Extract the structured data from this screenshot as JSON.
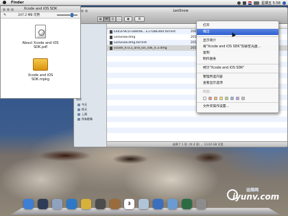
{
  "menubar": {
    "app_name": "Finder",
    "clock": "星期五 5:58",
    "icons": [
      "wifi-icon",
      "volume-icon",
      "flag-icon",
      "battery-icon",
      "search-icon"
    ]
  },
  "desktop_drive": {
    "label": "XCode and iOS SDK"
  },
  "open_panel": {
    "title": "Xcode and iOS SDK",
    "info": "247.2 MB 可用",
    "items": [
      {
        "label": "About Xcode and iOS SDK.pdf",
        "icon": "pdf-document-icon"
      },
      {
        "label": "Xcode and iOS SDK.mpkg",
        "icon": "installer-package-icon"
      }
    ]
  },
  "finder": {
    "title": "LeoSnow",
    "files": [
      {
        "name": "E643F9E5F1B809E...E17D8E460.torrent",
        "date": "2009年8月30"
      },
      {
        "name": "LeoSnow.dmg",
        "date": "2011年6月5"
      },
      {
        "name": "LeoSnow.dmg.torrent",
        "date": "2011年6月9"
      },
      {
        "name": "xcode_4.0.2_and_ios_sdk_4.3.dmg",
        "date": "2011年6月5"
      }
    ],
    "sidebar": {
      "heading": "搜索",
      "items": [
        "今天",
        "昨天",
        "上周",
        "所有影像"
      ]
    },
    "status": "选择了 1 项（共 4 项），13.02 GB 可用"
  },
  "context_menu": {
    "items": [
      {
        "label": "打开",
        "highlighted": false
      },
      {
        "label": "推出",
        "highlighted": true
      },
      {
        "label": "显示简介",
        "highlighted": false
      },
      {
        "label": "将\"Xcode and iOS SDK\"刻录至光盘...",
        "highlighted": false
      },
      {
        "label": "复制",
        "highlighted": false
      },
      {
        "label": "制作替身",
        "highlighted": false
      },
      {
        "label": "拷贝\"Xcode and iOS SDK\"",
        "highlighted": false
      },
      {
        "label": "整理所选内容",
        "highlighted": false
      },
      {
        "label": "查看显示选项",
        "highlighted": false
      },
      {
        "label": "标签：",
        "highlighted": false
      },
      {
        "label": "文件夹操作设置...",
        "highlighted": false
      }
    ],
    "label_colors": [
      "#ffffff",
      "#f08a7a",
      "#f2b566",
      "#f1e26a",
      "#b2dc6c",
      "#86b6ee",
      "#c49be0",
      "#bdbdbd"
    ]
  },
  "dock": {
    "icons": [
      {
        "name": "finder-icon",
        "color": "#3d7fd6"
      },
      {
        "name": "dashboard-icon",
        "color": "#2f3c58"
      },
      {
        "name": "mail-icon",
        "color": "#8ea2c0"
      },
      {
        "name": "safari-icon",
        "color": "#2e78c8"
      },
      {
        "name": "ichat-icon",
        "color": "#d6b23a"
      },
      {
        "name": "facetime-icon",
        "color": "#4c4c4c"
      },
      {
        "name": "address-book-icon",
        "color": "#9b6b3c"
      },
      {
        "name": "ical-icon",
        "color": "#ffffff",
        "text": "3"
      },
      {
        "name": "preview-icon",
        "color": "#b0c4d8"
      },
      {
        "name": "itunes-icon",
        "color": "#3a6fc0"
      },
      {
        "name": "iphoto-icon",
        "color": "#6b9bd0"
      },
      {
        "name": "time-machine-icon",
        "color": "#2c6b44"
      },
      {
        "name": "system-preferences-icon",
        "color": "#8c8c8c"
      }
    ]
  },
  "watermark": {
    "cn": "运维网",
    "text": "iyunv.com"
  }
}
